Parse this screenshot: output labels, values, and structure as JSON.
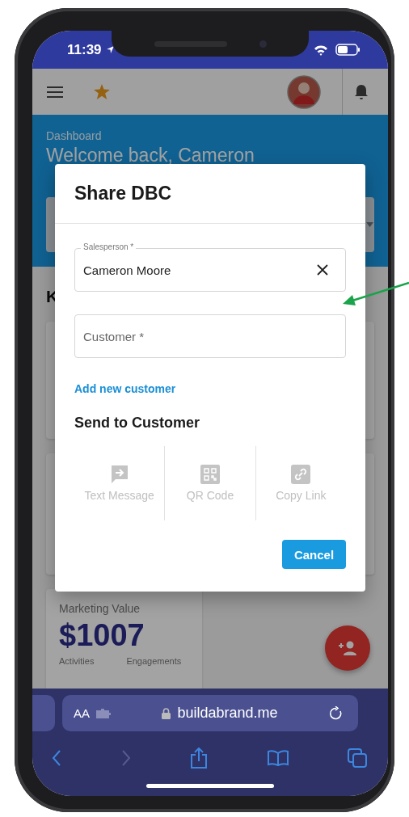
{
  "status_bar": {
    "time": "11:39"
  },
  "header": {
    "breadcrumb": "Dashboard",
    "greeting": "Welcome back, Cameron"
  },
  "section_heading": "K",
  "marketing_card": {
    "title": "Marketing Value",
    "value": "$1007",
    "stats": [
      {
        "label": "Activities"
      },
      {
        "label": "Engagements"
      }
    ]
  },
  "dialog": {
    "title": "Share DBC",
    "fields": [
      {
        "label": "Salesperson *",
        "value": "Cameron Moore",
        "clearable": true
      },
      {
        "placeholder": "Customer *",
        "clearable": false
      }
    ],
    "link": "Add new customer",
    "section_title": "Send to Customer",
    "share_options": [
      {
        "kind": "sms",
        "label": "Text Message",
        "disabled": true
      },
      {
        "kind": "qr",
        "label": "QR Code",
        "disabled": true
      },
      {
        "kind": "link",
        "label": "Copy Link",
        "disabled": true
      }
    ],
    "buttons": [
      {
        "label": "Cancel"
      }
    ]
  },
  "browser": {
    "text_size": "AA",
    "url": "buildabrand.me"
  }
}
